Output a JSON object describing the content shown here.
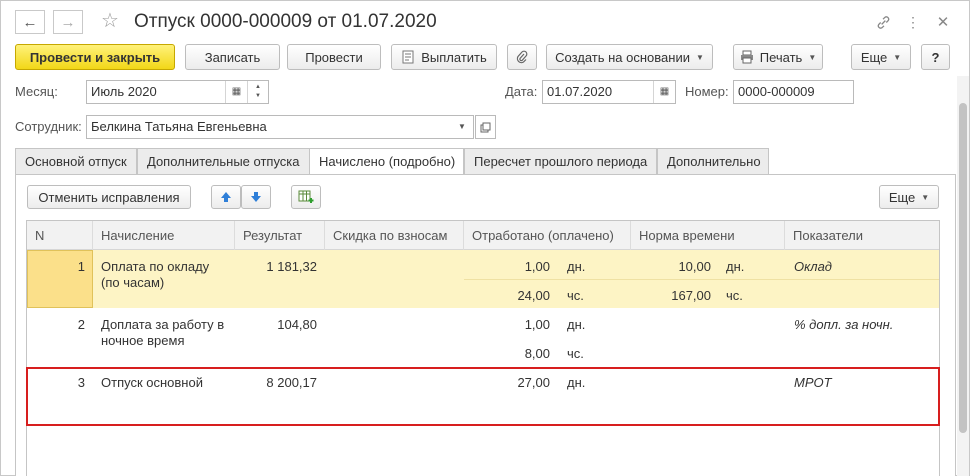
{
  "window": {
    "title": "Отпуск 0000-000009 от 01.07.2020",
    "icons": [
      "arrow-left-icon",
      "arrow-right-icon",
      "star-icon",
      "link-icon",
      "more-vert-icon",
      "close-icon"
    ]
  },
  "toolbar": {
    "post_and_close": "Провести и закрыть",
    "save": "Записать",
    "post": "Провести",
    "pay": "Выплатить",
    "create_based_on": "Создать на основании",
    "print": "Печать",
    "more": "Еще",
    "help": "?"
  },
  "fields": {
    "month_label": "Месяц:",
    "month_value": "Июль 2020",
    "date_label": "Дата:",
    "date_value": "01.07.2020",
    "number_label": "Номер:",
    "number_value": "0000-000009",
    "employee_label": "Сотрудник:",
    "employee_value": "Белкина Татьяна Евгеньевна"
  },
  "tabs": [
    {
      "label": "Основной отпуск",
      "active": false
    },
    {
      "label": "Дополнительные отпуска",
      "active": false
    },
    {
      "label": "Начислено (подробно)",
      "active": true
    },
    {
      "label": "Пересчет прошлого периода",
      "active": false
    },
    {
      "label": "Дополнительно",
      "active": false
    }
  ],
  "panel_toolbar": {
    "cancel_corrections": "Отменить исправления",
    "more": "Еще"
  },
  "table": {
    "columns": [
      "N",
      "Начисление",
      "Результат",
      "Скидка по взносам",
      "Отработано (оплачено)",
      "Норма времени",
      "Показатели"
    ],
    "rows": [
      {
        "n": "1",
        "accrual_line1": "Оплата по окладу",
        "accrual_line2": "(по часам)",
        "result": "1 181,32",
        "worked1": "1,00",
        "worked1_unit": "дн.",
        "worked2": "24,00",
        "worked2_unit": "чс.",
        "norm1": "10,00",
        "norm1_unit": "дн.",
        "norm2": "167,00",
        "norm2_unit": "чс.",
        "indicator": "Оклад"
      },
      {
        "n": "2",
        "accrual_line1": "Доплата за работу в",
        "accrual_line2": "ночное время",
        "result": "104,80",
        "worked1": "1,00",
        "worked1_unit": "дн.",
        "worked2": "8,00",
        "worked2_unit": "чс.",
        "indicator": "% допл. за ночн."
      },
      {
        "n": "3",
        "accrual_line1": "Отпуск основной",
        "result": "8 200,17",
        "worked1": "27,00",
        "worked1_unit": "дн.",
        "indicator": "МРОТ"
      }
    ]
  },
  "colors": {
    "primary_button": "#f5dc2a",
    "selected_row": "#fdf4c5",
    "selected_cell": "#fbe08a",
    "highlight_border": "#d71e1e"
  }
}
